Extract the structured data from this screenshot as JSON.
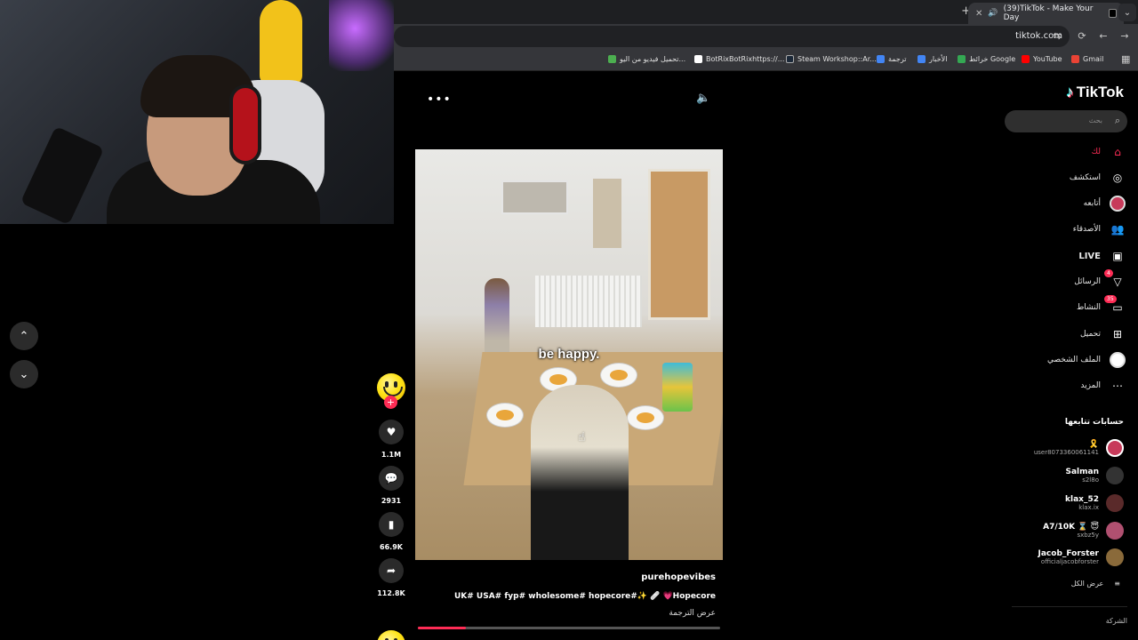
{
  "browser": {
    "tab_title": "(39)TikTok - Make Your Day",
    "url": "tiktok.com",
    "bookmarks": [
      {
        "label": "Gmail",
        "color": "#ea4335"
      },
      {
        "label": "YouTube",
        "color": "#ff0000"
      },
      {
        "label": "خرائط Google",
        "color": "#34a853"
      },
      {
        "label": "الأخبار",
        "color": "#4285f4"
      },
      {
        "label": "ترجمة",
        "color": "#4285f4"
      },
      {
        "label": "Steam Workshop::Ar...",
        "color": "#1b2838"
      },
      {
        "label": "BotRixBotRixhttps://...",
        "color": "#222222"
      },
      {
        "label": "تحميل فيديو من اليو...",
        "color": "#4caf50"
      }
    ]
  },
  "tiktok": {
    "logo_text": "TikTok",
    "search_placeholder": "بحث",
    "nav": [
      {
        "label": "لك",
        "icon": "home-icon",
        "active": true
      },
      {
        "label": "استكشف",
        "icon": "compass-icon",
        "active": false
      },
      {
        "label": "أتابعه",
        "icon": "following-avatar-icon",
        "active": false
      },
      {
        "label": "الأصدقاء",
        "icon": "friends-icon",
        "active": false
      },
      {
        "label": "LIVE",
        "icon": "live-icon",
        "active": false
      },
      {
        "label": "الرسائل",
        "icon": "messages-icon",
        "active": false,
        "badge": "4"
      },
      {
        "label": "النشاط",
        "icon": "activity-icon",
        "active": false,
        "badge": "35"
      },
      {
        "label": "تحميل",
        "icon": "upload-icon",
        "active": false
      },
      {
        "label": "الملف الشخصي",
        "icon": "profile-avatar-icon",
        "active": false
      },
      {
        "label": "المزيد",
        "icon": "more-icon",
        "active": false
      }
    ],
    "following_title": "حسابات تتابعها",
    "following": [
      {
        "name": "🎗️",
        "username": "user8073360061141",
        "color": "#c73a5a"
      },
      {
        "name": "Salman",
        "username": "s2l8o",
        "color": "#333333"
      },
      {
        "name": "klax_52",
        "username": "klax.ix",
        "color": "#5a2a2a"
      },
      {
        "name": "A7/10K ⌛ 😇",
        "username": "sxbz5y",
        "color": "#b05070"
      },
      {
        "name": "Jacob_Forster",
        "username": "officialjacobforster",
        "color": "#8a6a3a"
      }
    ],
    "see_all": "عرض الكل",
    "company": "الشركة"
  },
  "video": {
    "caption_overlay": "be happy.",
    "author": "purehopevibes",
    "description": "UK# USA# fyp# wholesome# hopecore#✨ 🩹 💗Hopecore",
    "translate": "عرض الترجمة",
    "progress": 0.16
  },
  "actions": {
    "likes": "1.1M",
    "comments": "2931",
    "saves": "66.9K",
    "shares": "112.8K"
  }
}
